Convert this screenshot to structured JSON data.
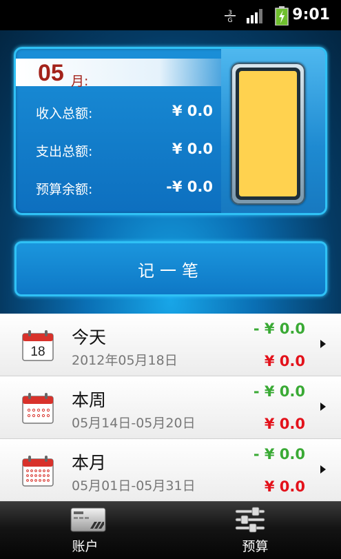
{
  "status_bar": {
    "time": "9:01",
    "icons": [
      "data-signal-icon",
      "signal-bars-icon",
      "battery-charging-icon"
    ]
  },
  "summary": {
    "month_number": "05",
    "month_unit": "月:",
    "rows": [
      {
        "label": "收入总额:",
        "value": "¥ 0.0"
      },
      {
        "label": "支出总额:",
        "value": "¥ 0.0"
      },
      {
        "label": "预算余额:",
        "value": "-¥ 0.0"
      }
    ],
    "budget_fill_fraction": 1.0,
    "budget_color": "#ffd24f"
  },
  "record_button": {
    "label": "记一笔"
  },
  "periods": [
    {
      "title": "今天",
      "date": "2012年05月18日",
      "income": "- ¥ 0.0",
      "expense": "¥ 0.0",
      "calendar_day": "18"
    },
    {
      "title": "本周",
      "date": "05月14日-05月20日",
      "income": "- ¥ 0.0",
      "expense": "¥ 0.0"
    },
    {
      "title": "本月",
      "date": "05月01日-05月31日",
      "income": "- ¥ 0.0",
      "expense": "¥ 0.0"
    }
  ],
  "colors": {
    "income": "#3aaa35",
    "expense": "#e3121b",
    "month": "#a3221a",
    "accent": "#2fc1f5"
  },
  "bottom_nav": {
    "tabs": [
      {
        "label": "账户",
        "icon": "account-card-icon"
      },
      {
        "label": "预算",
        "icon": "budget-sliders-icon"
      }
    ]
  }
}
